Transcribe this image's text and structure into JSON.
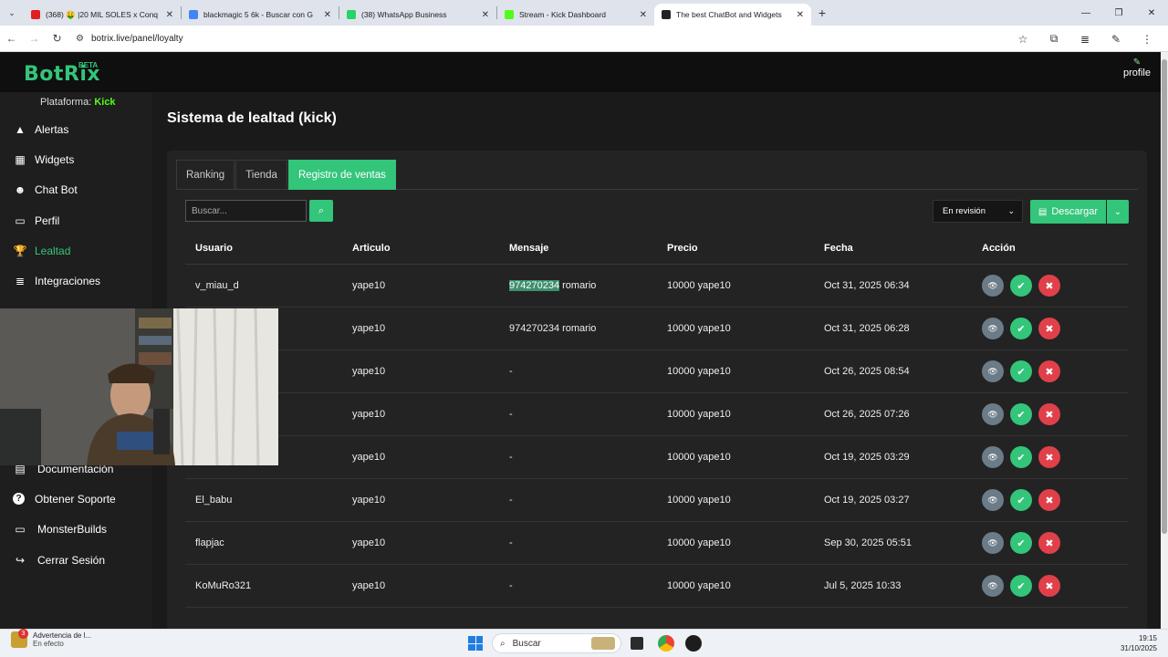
{
  "browser": {
    "tabs": [
      {
        "title": "(368) 🤑 |20 MIL SOLES x Conq",
        "icon": "youtube-icon",
        "color": "#e02020",
        "active": false
      },
      {
        "title": "blackmagic 5 6k - Buscar con G",
        "icon": "google-icon",
        "color": "#4285f4",
        "active": false
      },
      {
        "title": "(38) WhatsApp Business",
        "icon": "whatsapp-icon",
        "color": "#25d366",
        "active": false
      },
      {
        "title": "Stream - Kick Dashboard",
        "icon": "kick-icon",
        "color": "#53fc18",
        "active": false
      },
      {
        "title": "The best ChatBot and Widgets",
        "icon": "botrix-icon",
        "color": "#222222",
        "active": true
      }
    ],
    "url": "botrix.live/panel/loyalty"
  },
  "app": {
    "logo": "BotRix",
    "beta": "BETA",
    "profile_label": "profile",
    "accent": "#33c57a"
  },
  "sidebar": {
    "platform_label": "Plataforma:",
    "platform_value": "Kick",
    "items": [
      {
        "label": "Alertas",
        "icon": "warning-icon"
      },
      {
        "label": "Widgets",
        "icon": "grid-icon"
      },
      {
        "label": "Chat Bot",
        "icon": "robot-icon"
      },
      {
        "label": "Perfil",
        "icon": "id-card-icon"
      },
      {
        "label": "Lealtad",
        "icon": "trophy-icon",
        "active": true
      },
      {
        "label": "Integraciones",
        "icon": "stack-icon"
      },
      {
        "label": "Documentación",
        "icon": "book-icon"
      },
      {
        "label": "Obtener Soporte",
        "icon": "question-icon"
      },
      {
        "label": "MonsterBuilds",
        "icon": "laptop-icon"
      },
      {
        "label": "Cerrar Sesión",
        "icon": "logout-icon"
      }
    ]
  },
  "main": {
    "title": "Sistema de lealtad (kick)",
    "tabs": [
      "Ranking",
      "Tienda",
      "Registro de ventas"
    ],
    "search_placeholder": "Buscar...",
    "status_filter": "En revisión",
    "download_label": "Descargar",
    "columns": [
      "Usuario",
      "Articulo",
      "Mensaje",
      "Precio",
      "Fecha",
      "Acción"
    ],
    "rows": [
      {
        "user": "v_miau_d",
        "item": "yape10",
        "msg_hl": "974270234",
        "msg": " romario",
        "price": "10000 yape10",
        "date": "Oct 31, 2025 06:34"
      },
      {
        "user": "",
        "item": "yape10",
        "msg_hl": "",
        "msg": "974270234 romario",
        "price": "10000 yape10",
        "date": "Oct 31, 2025 06:28"
      },
      {
        "user": "",
        "item": "yape10",
        "msg_hl": "",
        "msg": "-",
        "price": "10000 yape10",
        "date": "Oct 26, 2025 08:54"
      },
      {
        "user": "",
        "item": "yape10",
        "msg_hl": "",
        "msg": "-",
        "price": "10000 yape10",
        "date": "Oct 26, 2025 07:26"
      },
      {
        "user": "",
        "item": "yape10",
        "msg_hl": "",
        "msg": "-",
        "price": "10000 yape10",
        "date": "Oct 19, 2025 03:29"
      },
      {
        "user": "El_babu",
        "item": "yape10",
        "msg_hl": "",
        "msg": "-",
        "price": "10000 yape10",
        "date": "Oct 19, 2025 03:27"
      },
      {
        "user": "flapjac",
        "item": "yape10",
        "msg_hl": "",
        "msg": "-",
        "price": "10000 yape10",
        "date": "Sep 30, 2025 05:51"
      },
      {
        "user": "KoMuRo321",
        "item": "yape10",
        "msg_hl": "",
        "msg": "-",
        "price": "10000 yape10",
        "date": "Jul 5, 2025 10:33"
      }
    ]
  },
  "taskbar": {
    "notif_title": "Advertencia de l...",
    "notif_sub": "En efecto",
    "notif_badge": "3",
    "search_label": "Buscar",
    "time": "19:15",
    "date": "31/10/2025"
  }
}
